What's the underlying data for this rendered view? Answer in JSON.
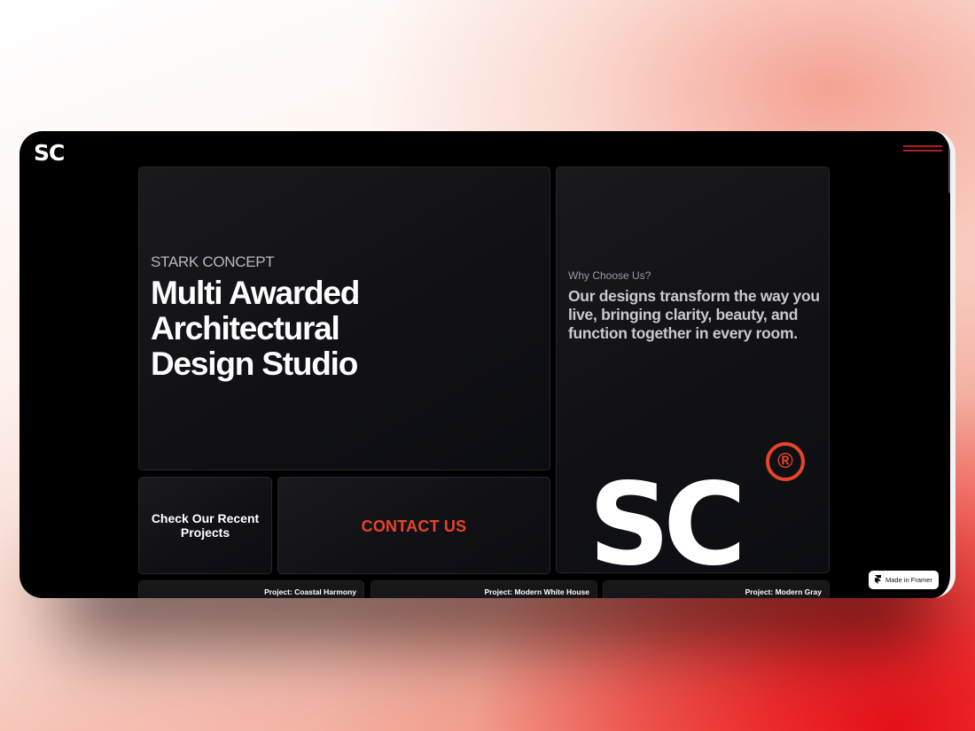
{
  "header": {
    "logo_text": "SC",
    "logo_mark": "®",
    "menu_icon": "hamburger-icon"
  },
  "hero": {
    "eyebrow": "STARK CONCEPT",
    "title": "Multi Awarded Architectural Design Studio"
  },
  "why": {
    "label": "Why Choose Us?",
    "text": "Our designs transform the way you live, bringing clarity, beauty, and function together in every room.",
    "logo_text": "SC",
    "logo_mark": "®"
  },
  "buttons": {
    "projects_label": "Check Our Recent Projects",
    "contact_label": "CONTACT US"
  },
  "projects": [
    {
      "label": "Project: Coastal Harmony"
    },
    {
      "label": "Project: Modern White House"
    },
    {
      "label": "Project: Modern Gray"
    }
  ],
  "badge": {
    "icon": "framer-icon",
    "label": "Made in Framer"
  },
  "colors": {
    "accent": "#e8442a",
    "background": "#000000",
    "card": "#141418"
  }
}
